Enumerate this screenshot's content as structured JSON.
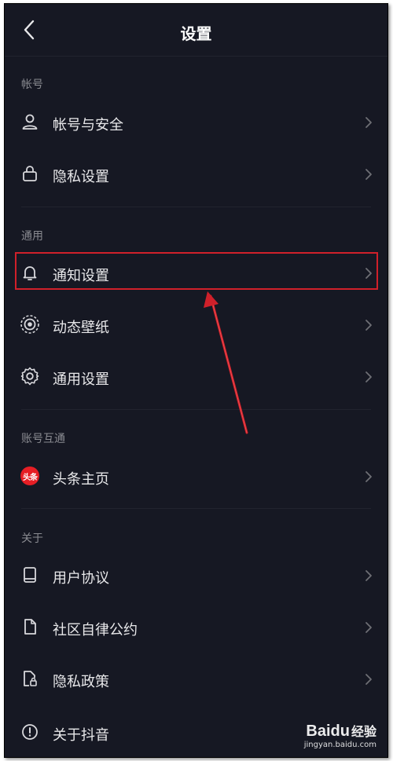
{
  "header": {
    "title": "设置"
  },
  "sections": [
    {
      "label": "帐号",
      "items": [
        {
          "label": "帐号与安全",
          "icon": "user-icon"
        },
        {
          "label": "隐私设置",
          "icon": "lock-icon"
        }
      ]
    },
    {
      "label": "通用",
      "items": [
        {
          "label": "通知设置",
          "icon": "bell-icon"
        },
        {
          "label": "动态壁纸",
          "icon": "live-wallpaper-icon"
        },
        {
          "label": "通用设置",
          "icon": "gear-icon"
        }
      ]
    },
    {
      "label": "账号互通",
      "items": [
        {
          "label": "头条主页",
          "icon": "toutiao-logo-icon",
          "badge_text": "头条"
        }
      ]
    },
    {
      "label": "关于",
      "items": [
        {
          "label": "用户协议",
          "icon": "book-icon"
        },
        {
          "label": "社区自律公约",
          "icon": "document-icon"
        },
        {
          "label": "隐私政策",
          "icon": "privacy-doc-icon"
        },
        {
          "label": "关于抖音",
          "icon": "info-icon"
        }
      ]
    }
  ],
  "annotation": {
    "highlight_color": "#d0202a",
    "highlighted_item": "通知设置"
  },
  "watermark": {
    "logo": "Bai",
    "logo_suffix": "du",
    "logo_cn": "经验",
    "url": "jingyan.baidu.com"
  },
  "colors": {
    "background": "#161823",
    "text": "#e8e8ea",
    "section_label": "#8a8b91",
    "chevron": "#6e6f75"
  }
}
